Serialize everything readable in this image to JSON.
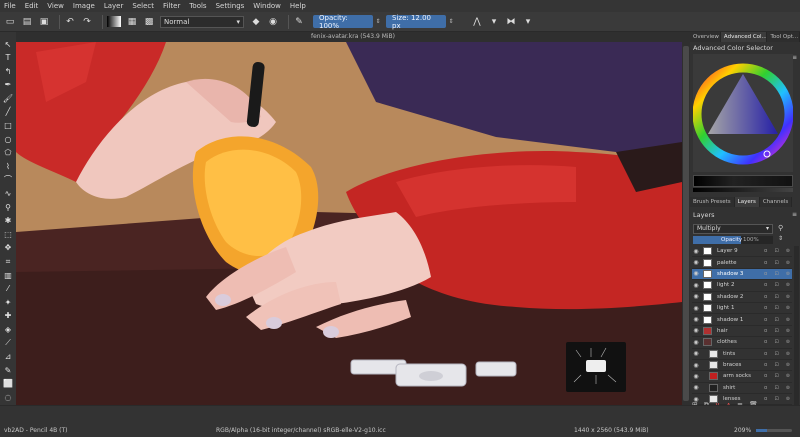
{
  "menu": [
    "File",
    "Edit",
    "View",
    "Image",
    "Layer",
    "Select",
    "Filter",
    "Tools",
    "Settings",
    "Window",
    "Help"
  ],
  "toolbar": {
    "blend_mode": "Normal",
    "opacity_label": "Opacity: 100%",
    "size_label": "Size: 12.00 px"
  },
  "document": {
    "title": "fenix-avatar.kra (543.9 MiB)"
  },
  "dock": {
    "top_tabs": [
      "Overview",
      "Advanced Col...",
      "Tool Opt..."
    ],
    "color_selector_title": "Advanced Color Selector",
    "mid_tabs": [
      "Brush Presets",
      "Layers",
      "Channels"
    ],
    "layers_title": "Layers",
    "layer_blend_mode": "Multiply",
    "layer_opacity_label": "Opacity",
    "layer_opacity_rest": "100%",
    "layers": [
      {
        "name": "Layer 9",
        "selected": false,
        "indent": 0,
        "thumb": "#ffffff"
      },
      {
        "name": "palette",
        "selected": false,
        "indent": 0,
        "thumb": "#ffffff"
      },
      {
        "name": "shadow 3",
        "selected": true,
        "indent": 0,
        "thumb": "#ffffff"
      },
      {
        "name": "light 2",
        "selected": false,
        "indent": 0,
        "thumb": "#ffffff"
      },
      {
        "name": "shadow 2",
        "selected": false,
        "indent": 0,
        "thumb": "#ffffff"
      },
      {
        "name": "light 1",
        "selected": false,
        "indent": 0,
        "thumb": "#ffffff"
      },
      {
        "name": "shadow 1",
        "selected": false,
        "indent": 0,
        "thumb": "#ffffff"
      },
      {
        "name": "hair",
        "selected": false,
        "indent": 0,
        "thumb": "#b03030"
      },
      {
        "name": "clothes",
        "selected": false,
        "indent": 0,
        "thumb": "#5a3030"
      },
      {
        "name": "tints",
        "selected": false,
        "indent": 1,
        "thumb": "#e8e8e8"
      },
      {
        "name": "braces",
        "selected": false,
        "indent": 1,
        "thumb": "#e8e8e8"
      },
      {
        "name": "arm socks",
        "selected": false,
        "indent": 1,
        "thumb": "#c02020"
      },
      {
        "name": "shirt",
        "selected": false,
        "indent": 1,
        "thumb": "#202020"
      },
      {
        "name": "lenses",
        "selected": false,
        "indent": 1,
        "thumb": "#e8e8e8"
      }
    ]
  },
  "status": {
    "brush": "vb2AD - Pencil 4B (T)",
    "color_space": "RGB/Alpha (16-bit integer/channel)  sRGB-elle-V2-g10.icc",
    "image_size": "1440 x 2560 (543.9 MiB)",
    "zoom": "209%"
  },
  "colors": {
    "accent": "#3f6ea8",
    "panel": "#323232",
    "menubar": "#353535"
  }
}
